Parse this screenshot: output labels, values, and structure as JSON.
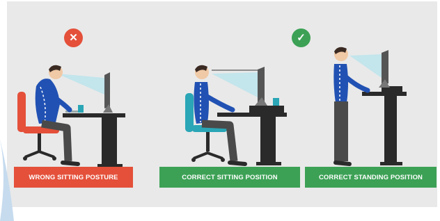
{
  "colors": {
    "background": "#e9e9e9",
    "wrong": "#e4503a",
    "correct": "#3ca155",
    "shirt": "#2151b3",
    "pants": "#4a4a4a",
    "desk": "#2a2a2a",
    "chair_red": "#e4503a",
    "chair_teal": "#2aa6b6",
    "sightline": "#bfe4ec"
  },
  "badges": {
    "wrong_icon": "x-mark",
    "wrong_glyph": "✕",
    "correct_icon": "check-mark",
    "correct_glyph": "✓"
  },
  "labels": {
    "wrong": "WRONG SITTING POSTURE",
    "correct_sitting": "CORRECT SITTING POSITION",
    "correct_standing": "CORRECT STANDING POSITION"
  }
}
